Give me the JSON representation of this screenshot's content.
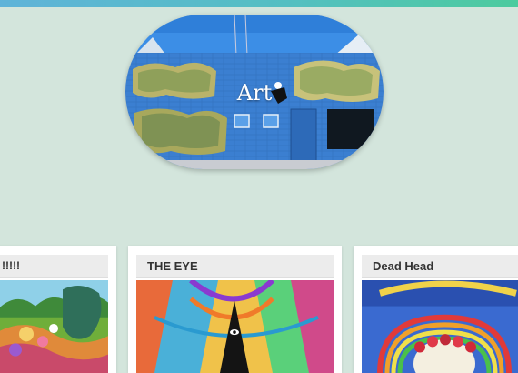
{
  "hero": {
    "title": "Art",
    "image": "graffiti-wall-photo"
  },
  "cards": [
    {
      "title": "!!!!!",
      "image": "psychedelic-landscape-painting"
    },
    {
      "title": "THE EYE",
      "image": "psychedelic-eye-pyramid-painting"
    },
    {
      "title": "Dead Head",
      "image": "grateful-dead-skull-roses-poster"
    }
  ],
  "colors": {
    "page_background": "#d3e5dc",
    "top_bar_start": "#5fb3d9",
    "top_bar_end": "#4ccb9e",
    "card_header": "#ececec",
    "card_title": "#333333"
  }
}
